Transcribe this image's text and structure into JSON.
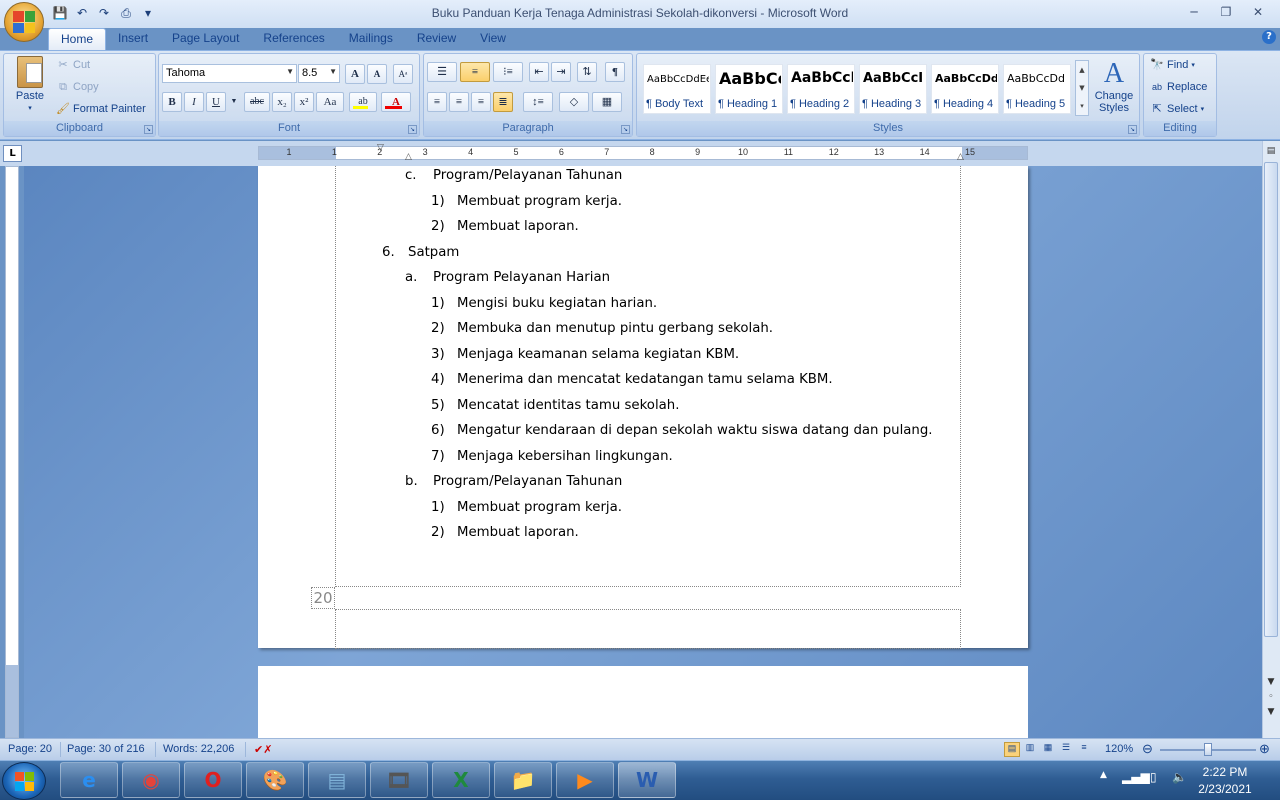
{
  "window": {
    "title": "Buku Panduan Kerja Tenaga Administrasi Sekolah-dikonversi - Microsoft Word",
    "min_icon": "minimize-icon",
    "max_icon": "maximize-icon",
    "close_icon": "close-icon",
    "min_glyph": "─",
    "max_glyph": "❐",
    "close_glyph": "✕"
  },
  "qat": {
    "save": "💾",
    "undo": "↶",
    "redo": "↷",
    "print": "⎙",
    "more": "▾"
  },
  "tabs": [
    "Home",
    "Insert",
    "Page Layout",
    "References",
    "Mailings",
    "Review",
    "View"
  ],
  "help_glyph": "?",
  "clipboard": {
    "paste_label": "Paste",
    "cut_label": "Cut",
    "copy_label": "Copy",
    "format_painter_label": "Format Painter",
    "group_label": "Clipboard"
  },
  "font": {
    "name": "Tahoma",
    "size": "8.5",
    "group_label": "Font",
    "bold": "B",
    "italic": "I",
    "underline": "U",
    "strike": "abc",
    "subscript": "x₂",
    "superscript": "x²",
    "case": "Aa",
    "grow": "A",
    "shrink": "A"
  },
  "paragraph": {
    "group_label": "Paragraph",
    "pilcrow": "¶"
  },
  "styles": {
    "group_label": "Styles",
    "items": [
      {
        "sample": "AaBbCcDdEe",
        "name": "¶ Body Text"
      },
      {
        "sample": "AaBbCc",
        "name": "¶ Heading 1"
      },
      {
        "sample": "AaBbCcI",
        "name": "¶ Heading 2"
      },
      {
        "sample": "AaBbCcI",
        "name": "¶ Heading 3"
      },
      {
        "sample": "AaBbCcDd",
        "name": "¶ Heading 4"
      },
      {
        "sample": "AaBbCcDd",
        "name": "¶ Heading 5"
      }
    ],
    "change_styles_label": "Change Styles"
  },
  "editing": {
    "group_label": "Editing",
    "find_label": "Find",
    "replace_label": "Replace",
    "select_label": "Select"
  },
  "ruler": {
    "numbers": [
      "1",
      "1",
      "2",
      "3",
      "4",
      "5",
      "6",
      "7",
      "8",
      "9",
      "10",
      "11",
      "12",
      "13",
      "14",
      "15"
    ]
  },
  "document": {
    "page_number_marker": "20",
    "lines": [
      {
        "marker": "c.",
        "text": "Program/Pelayanan Tahunan",
        "level": 2
      },
      {
        "marker": "1)",
        "text": "Membuat program kerja.",
        "level": 3
      },
      {
        "marker": "2)",
        "text": "Membuat laporan.",
        "level": 3
      },
      {
        "marker": "6.",
        "text": "Satpam",
        "level": 1
      },
      {
        "marker": "a.",
        "text": "Program Pelayanan Harian",
        "level": 2
      },
      {
        "marker": "1)",
        "text": "Mengisi buku kegiatan harian.",
        "level": 3
      },
      {
        "marker": "2)",
        "text": "Membuka dan menutup pintu gerbang sekolah.",
        "level": 3
      },
      {
        "marker": "3)",
        "text": "Menjaga keamanan selama kegiatan KBM.",
        "level": 3
      },
      {
        "marker": "4)",
        "text": "Menerima dan mencatat kedatangan tamu selama KBM.",
        "level": 3
      },
      {
        "marker": "5)",
        "text": "Mencatat identitas tamu sekolah.",
        "level": 3
      },
      {
        "marker": "6)",
        "text": "Mengatur kendaraan di depan sekolah waktu siswa datang dan pulang.",
        "level": 3
      },
      {
        "marker": "7)",
        "text": "Menjaga kebersihan lingkungan.",
        "level": 3
      },
      {
        "marker": "b.",
        "text": "Program/Pelayanan Tahunan",
        "level": 2
      },
      {
        "marker": "1)",
        "text": "Membuat program kerja.",
        "level": 3
      },
      {
        "marker": "2)",
        "text": "Membuat laporan.",
        "level": 3
      }
    ]
  },
  "status": {
    "page": "Page: 20",
    "page_of": "Page: 30 of 216",
    "words": "Words: 22,206",
    "zoom": "120%"
  },
  "taskbar": {
    "apps": [
      {
        "icon": "internet-explorer-icon",
        "glyph": "e"
      },
      {
        "icon": "chrome-icon",
        "glyph": "◉"
      },
      {
        "icon": "opera-icon",
        "glyph": "O"
      },
      {
        "icon": "paint-icon",
        "glyph": "🎨"
      },
      {
        "icon": "notepad-icon",
        "glyph": "▤"
      },
      {
        "icon": "media-icon",
        "glyph": "🎞"
      },
      {
        "icon": "excel-icon",
        "glyph": "X"
      },
      {
        "icon": "folder-icon",
        "glyph": "📁"
      },
      {
        "icon": "video-player-icon",
        "glyph": "▶"
      },
      {
        "icon": "word-icon",
        "glyph": "W"
      }
    ],
    "time": "2:22 PM",
    "date": "2/23/2021"
  },
  "colors": {
    "accent": "#15428b",
    "ribbon": "#c9d9ee",
    "workspace": "#6a93c5"
  }
}
